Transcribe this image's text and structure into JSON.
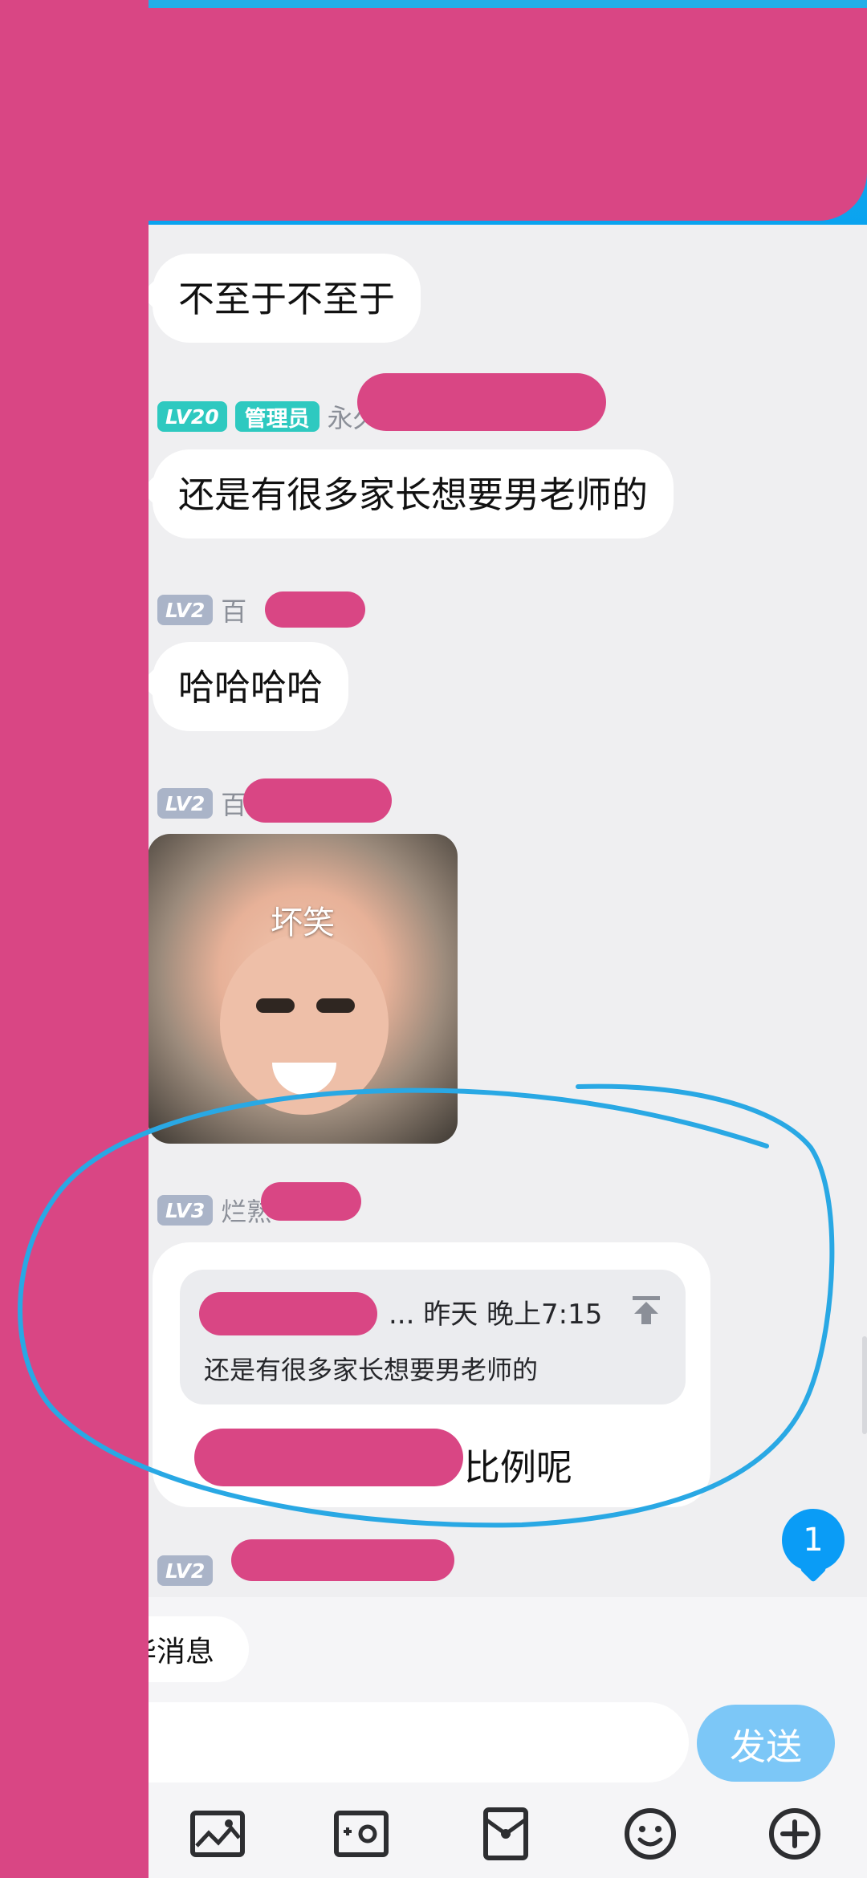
{
  "messages": [
    {
      "text": "不至于不至于"
    },
    {
      "level": "LV20",
      "role": "管理员",
      "sender": "永久"
    },
    {
      "text": "还是有很多家长想要男老师的"
    },
    {
      "level": "LV2",
      "sender": "百"
    },
    {
      "text": "哈哈哈哈"
    },
    {
      "level": "LV2",
      "sender": "百"
    },
    {
      "sticker_caption": "坏笑"
    },
    {
      "level": "LV3",
      "sender": "烂熟"
    },
    {
      "quote_time": "... 昨天 晚上7:15",
      "quote_text": "还是有很多家长想要男老师的",
      "reply_text": "比例呢"
    },
    {
      "level": "LV2"
    }
  ],
  "unread_count": "1",
  "essence_label": "精华消息",
  "send_label": "发送",
  "toolbar": [
    "image-icon",
    "camera-icon",
    "redpacket-icon",
    "emoji-icon",
    "plus-icon"
  ]
}
